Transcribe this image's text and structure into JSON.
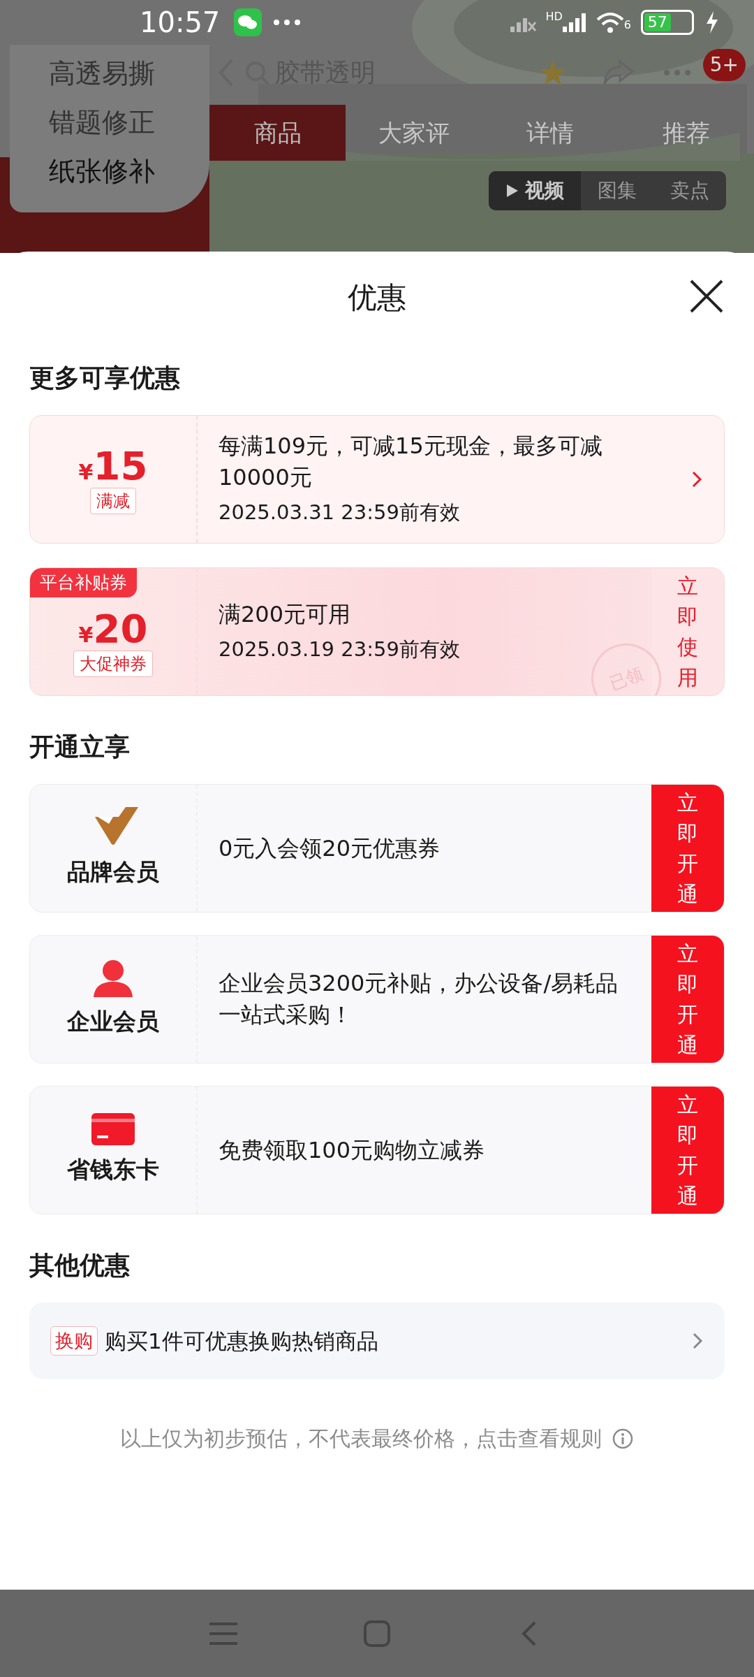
{
  "status_bar": {
    "time": "10:57",
    "network": "HD",
    "wifi_label": "6",
    "battery": "57"
  },
  "background_page": {
    "search_placeholder": "胶带透明",
    "badge": "5+",
    "tabs": [
      {
        "label": "商品",
        "selected": true
      },
      {
        "label": "大家评",
        "selected": false
      },
      {
        "label": "详情",
        "selected": false
      },
      {
        "label": "推荐",
        "selected": false
      }
    ],
    "media_tabs": [
      {
        "label": "视频",
        "selected": true
      },
      {
        "label": "图集",
        "selected": false
      },
      {
        "label": "卖点",
        "selected": false
      }
    ]
  },
  "popup_menu": {
    "items": [
      "高透易撕",
      "错题修正",
      "纸张修补"
    ]
  },
  "sheet": {
    "title": "优惠",
    "coupon_section": {
      "title": "更多可享优惠",
      "coupons": [
        {
          "kind": "discount",
          "currency": "¥",
          "amount": "15",
          "tag": "满减",
          "desc": "每满109元，可减15元现金，最多可减10000元",
          "validity": "2025.03.31 23:59前有效"
        },
        {
          "kind": "platform",
          "corner_label": "平台补贴券",
          "currency": "¥",
          "amount": "20",
          "tag": "大促神券",
          "desc": "满200元可用",
          "validity": "2025.03.19 23:59前有效",
          "action": "立即使用",
          "stamp": "已领"
        }
      ]
    },
    "member_section": {
      "title": "开通立享",
      "memberships": [
        {
          "kind": "brand",
          "name": "品牌会员",
          "desc": "0元入会领20元优惠券",
          "action": "立即开通"
        },
        {
          "kind": "person",
          "name": "企业会员",
          "desc": "企业会员3200元补贴，办公设备/易耗品一站式采购！",
          "action": "立即开通"
        },
        {
          "kind": "card",
          "name": "省钱东卡",
          "desc": "免费领取100元购物立减券",
          "action": "立即开通"
        }
      ]
    },
    "other_section": {
      "title": "其他优惠",
      "offers": [
        {
          "tag": "换购",
          "text": "购买1件可优惠换购热销商品"
        }
      ]
    },
    "note": "以上仅为初步预估，不代表最终价格，点击查看规则"
  }
}
